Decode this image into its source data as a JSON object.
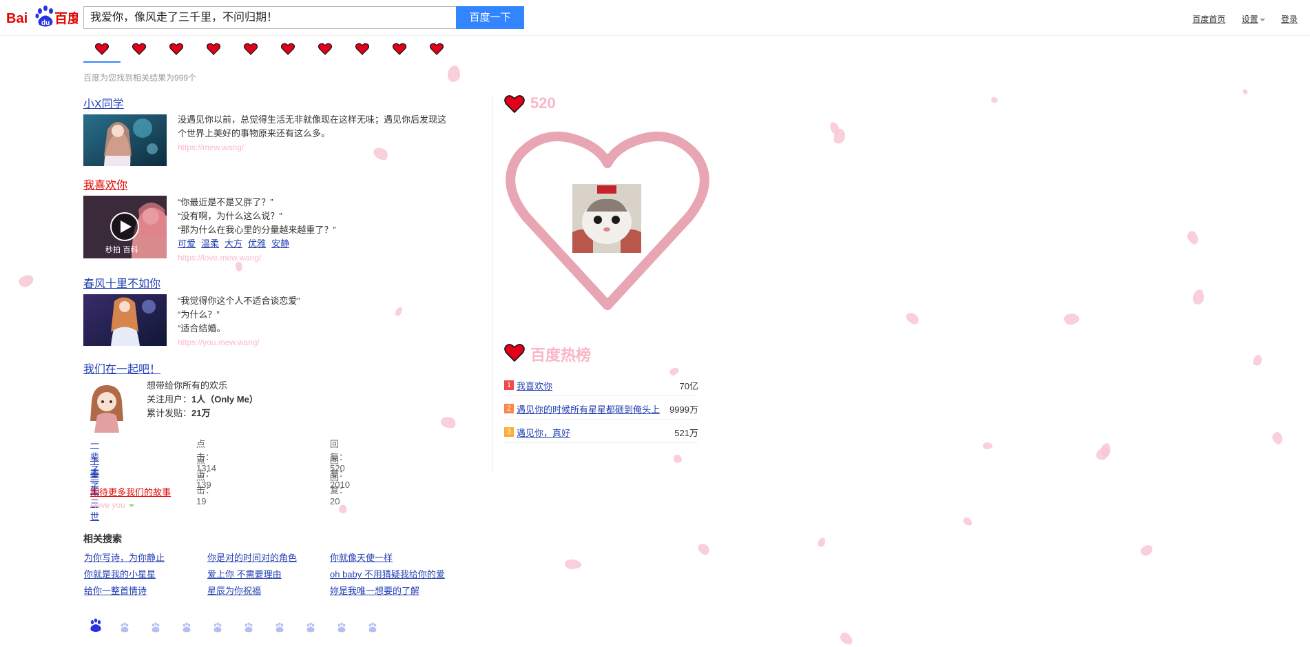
{
  "header": {
    "logo_text": "Bai du 百度",
    "search_value": "我爱你，像风走了三千里，不问归期！",
    "search_button": "百度一下",
    "links": [
      "百度首页",
      "设置",
      "登录"
    ]
  },
  "tabs": {
    "count": 10,
    "icon": "heart-icon"
  },
  "result_count": "百度为您找到相关结果为999个",
  "results": [
    {
      "title": "小X同学",
      "title_color": "#2440b3",
      "lines": [
        "没遇见你以前，总觉得生活无非就像现在这样无味；遇见你后发现这",
        "个世界上美好的事物原来还有这么多。"
      ],
      "url": "https://mew.wang/"
    },
    {
      "title": "我喜欢你",
      "title_color": "#e10601",
      "lines": [
        "“你最近是不是又胖了？”",
        "“没有啊，为什么这么说？”",
        "“那为什么在我心里的分量越来越重了？”"
      ],
      "tags": [
        "可爱",
        "温柔",
        "大方",
        "优雅",
        "安静"
      ],
      "url": "https://love.mew.wang/",
      "thumb_label": "秒拍 百科"
    },
    {
      "title": "春风十里不如你",
      "title_color": "#2440b3",
      "lines": [
        "“我觉得你这个人不适合谈恋爱”",
        "“为什么？”",
        "“适合结婚。"
      ],
      "url": "https://you.mew.wang/"
    },
    {
      "title": "我们在一起吧！",
      "title_color": "#2440b3"
    }
  ],
  "forum": {
    "desc": "想带给你所有的欢乐",
    "followers_label": "关注用户：",
    "followers_value": "1人（Only Me）",
    "posts_label": "累计发贴：",
    "posts_value": "21万",
    "rows": [
      {
        "name": "一辈子",
        "clicks": "点击：1314",
        "replies": "回复：520"
      },
      {
        "name": "下辈子",
        "clicks": "点击：139",
        "replies": "回复：2010"
      },
      {
        "name": "三生三世",
        "clicks": "点击：19",
        "replies": "回复：20"
      }
    ],
    "more": "期待更多我们的故事",
    "footer": "i love you"
  },
  "related": {
    "title": "相关搜索",
    "items": [
      "为你写诗，为你静止",
      "你是对的时间对的角色",
      "你就像天使一样",
      "你就是我的小星星",
      "爱上你 不需要理由",
      "oh baby 不用猜疑我给你的爱",
      "给你一整首情诗",
      "星辰为你祝福",
      "妳是我唯一想要的了解"
    ]
  },
  "right": {
    "card_title": "520",
    "hot_title": "百度热榜",
    "hot": [
      {
        "rank": "1",
        "label": "我喜欢你",
        "value": "70亿",
        "color": "#f54545"
      },
      {
        "rank": "2",
        "label": "遇见你的时候所有星星都砸到俺头上",
        "value": "9999万",
        "color": "#ff8547"
      },
      {
        "rank": "3",
        "label": "遇见你，真好",
        "value": "521万",
        "color": "#ffac38"
      }
    ]
  },
  "colors": {
    "accent": "#3385ff",
    "link": "#2440b3",
    "pink": "#f9b6c6",
    "heart_outline": "#e8a5b3"
  }
}
